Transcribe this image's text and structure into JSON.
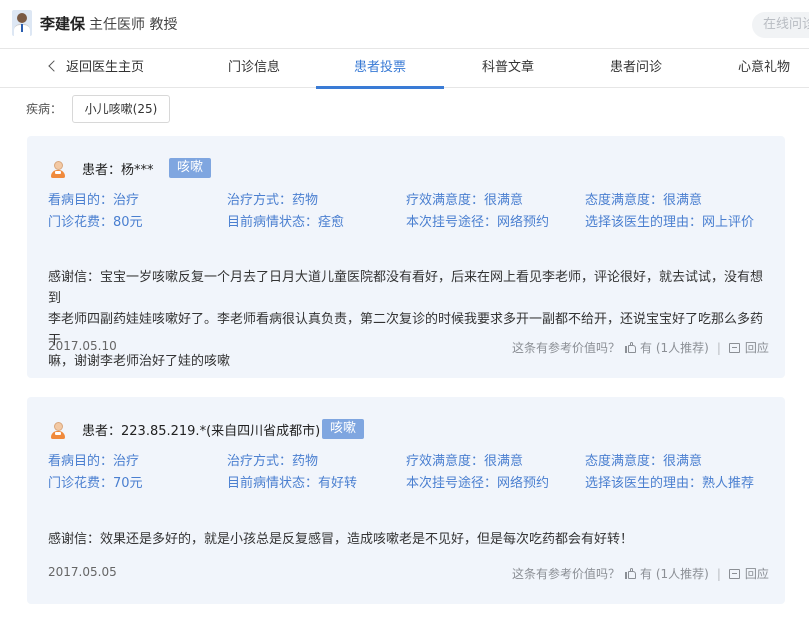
{
  "header": {
    "doctor_name": "李建保",
    "doctor_title": "主任医师 教授",
    "consult_button": "在线问诊"
  },
  "tabs": {
    "back": "返回医生主页",
    "items": [
      "门诊信息",
      "患者投票",
      "科普文章",
      "患者问诊",
      "心意礼物"
    ],
    "active": "患者投票"
  },
  "filter": {
    "label": "疾病：",
    "chip": "小儿咳嗽(25)"
  },
  "reviews": [
    {
      "patient": "患者：杨***",
      "tag": "咳嗽",
      "purpose": "看病目的：治疗",
      "treatment": "治疗方式：药物",
      "efficacy": "疗效满意度：很满意",
      "attitude": "态度满意度：很满意",
      "cost": "门诊花费：80元",
      "status": "目前病情状态：痊愈",
      "channel": "本次挂号途径：网络预约",
      "reason": "选择该医生的理由：网上评价",
      "content_lines": [
        "感谢信：宝宝一岁咳嗽反复一个月去了日月大道儿童医院都没有看好，后来在网上看见李老师，评论很好，就去试试，没有想到",
        "李老师四副药娃娃咳嗽好了。李老师看病很认真负责，第二次复诊的时候我要求多开一副都不给开，还说宝宝好了吃那么多药干",
        "嘛，谢谢李老师治好了娃的咳嗽"
      ],
      "date": "2017.05.10",
      "useful_prompt": "这条有参考价值吗？",
      "useful_count": "有 (1人推荐)",
      "reply": "回应"
    },
    {
      "patient": "患者：223.85.219.*(来自四川省成都市)",
      "tag": "咳嗽",
      "purpose": "看病目的：治疗",
      "treatment": "治疗方式：药物",
      "efficacy": "疗效满意度：很满意",
      "attitude": "态度满意度：很满意",
      "cost": "门诊花费：70元",
      "status": "目前病情状态：有好转",
      "channel": "本次挂号途径：网络预约",
      "reason": "选择该医生的理由：熟人推荐",
      "content_lines": [
        "感谢信：效果还是多好的，就是小孩总是反复感冒，造成咳嗽老是不见好，但是每次吃药都会有好转！"
      ],
      "date": "2017.05.05",
      "useful_prompt": "这条有参考价值吗？",
      "useful_count": "有 (1人推荐)",
      "reply": "回应"
    }
  ]
}
